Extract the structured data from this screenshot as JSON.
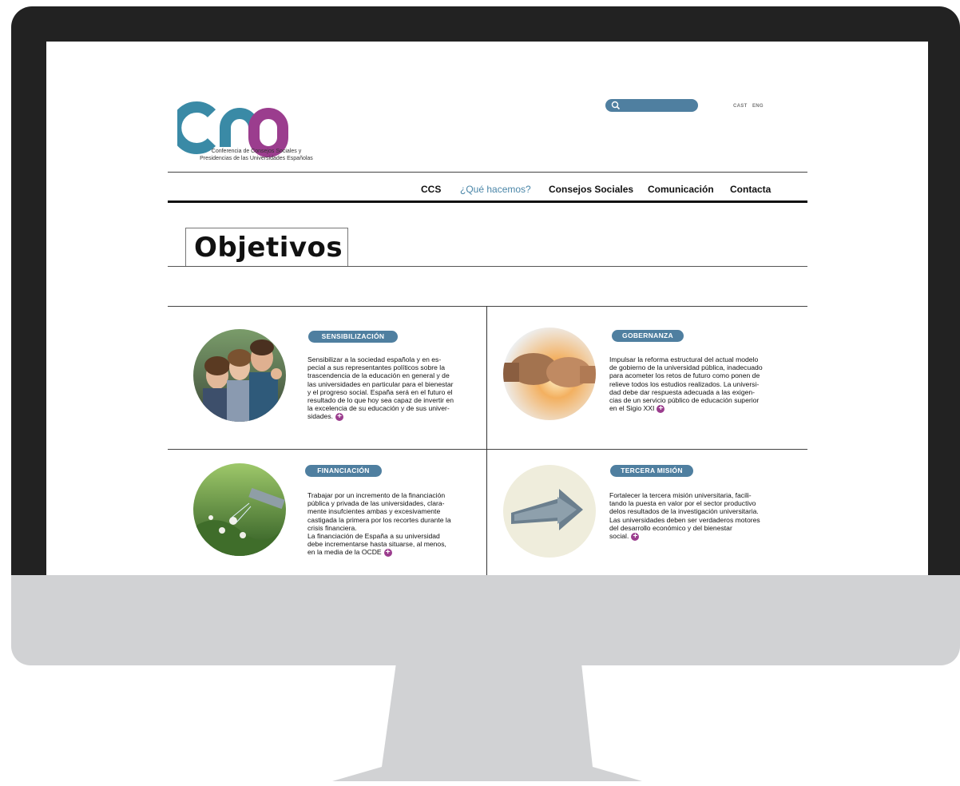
{
  "logo": {
    "tagline": "Conferencia de Consejos Sociales y\nPresidencias de las Universidades Españolas",
    "colors": {
      "teal": "#3a8aa6",
      "purple": "#9b3d8e"
    }
  },
  "header": {
    "search_placeholder": "",
    "lang_cast": "CAST",
    "lang_eng": "ENG"
  },
  "nav": {
    "items": [
      {
        "label": "CCS",
        "active": false
      },
      {
        "label": "¿Qué hacemos?",
        "active": true
      },
      {
        "label": "Consejos Sociales",
        "active": false
      },
      {
        "label": "Comunicación",
        "active": false
      },
      {
        "label": "Contacta",
        "active": false
      }
    ]
  },
  "page": {
    "title": "Objetivos"
  },
  "cards": [
    {
      "badge": "SENSIBILIZACIÓN",
      "text": "Sensibilizar a la sociedad española y en es-\npecial a sus representantes políticos sobre la\ntrascendencia de la educación en general y de\nlas universidades en particular para el bienestar\ny el progreso social. España será en el futuro el\nresultado de lo que hoy sea capaz de invertir en\nla excelencia de su educación y de sus univer-\nsidades.",
      "image": "group-of-students-photo"
    },
    {
      "badge": "GOBERNANZA",
      "text": "Impulsar la reforma estructural del actual modelo\nde gobierno de la universidad pública, inadecuado\npara acometer los retos de futuro como ponen de\nrelieve todos los estudios realizados. La universi-\ndad debe dar respuesta adecuada a las exigen-\ncias de un servicio público de educación superior\nen el Sigio XXI",
      "image": "fist-bump-photo"
    },
    {
      "badge": "FINANCIACIÓN",
      "text": "Trabajar por un incremento de la financiación\npública y privada de las universidades, clara-\nmente insufcientes ambas y excesivamente\ncastigada la primera por los recortes durante la\ncrisis financiera.\nLa financiación de España a su universidad\ndebe incrementarse hasta situarse, al menos,\nen la media de la OCDE",
      "image": "watering-plants-photo"
    },
    {
      "badge": "TERCERA MISIÓN",
      "text": "Fortalecer la tercera misión universitaria, facili-\ntando la puesta en valor por el sector productivo\ndelos resultados de la investigación universitaria.\nLas universidades deben ser verdaderos motores\ndel desarrollo económico y del bienestar\nsocial.",
      "image": "dotted-arrow-photo"
    }
  ],
  "more_icon": "plus-circle-icon",
  "accent_color": "#4f7fa0"
}
